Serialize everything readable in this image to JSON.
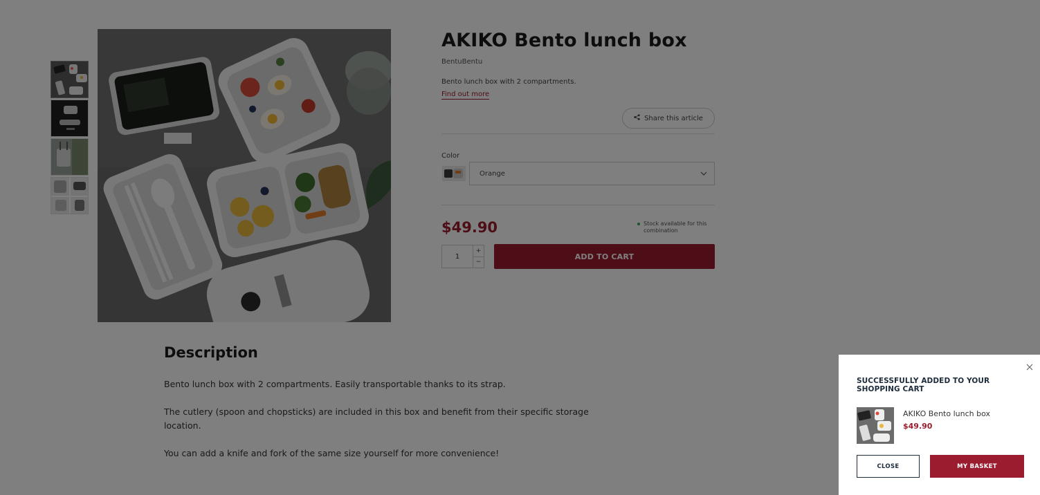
{
  "product": {
    "title": "AKIKO Bento lunch box",
    "brand": "BentuBentu",
    "short_description": "Bento lunch box with 2 compartments.",
    "find_more": "Find out more",
    "share_label": "Share this article",
    "color_label": "Color",
    "color_selected": "Orange",
    "price": "$49.90",
    "stock_text": "Stock available for this combination",
    "quantity": "1",
    "qty_plus": "+",
    "qty_minus": "−",
    "add_to_cart": "ADD TO CART"
  },
  "description": {
    "title": "Description",
    "paragraphs": [
      "Bento lunch box with 2 compartments. Easily transportable thanks to its strap.",
      "The cutlery (spoon and chopsticks) are included in this box and benefit from their specific storage location.",
      "You can add a knife and fork of the same size yourself for more convenience!"
    ]
  },
  "toast": {
    "title": "SUCCESSFULLY ADDED TO YOUR SHOPPING CART",
    "item_name": "AKIKO Bento lunch box",
    "item_price": "$49.90",
    "close_label": "CLOSE",
    "basket_label": "MY BASKET"
  },
  "colors": {
    "accent": "#9b1c2e",
    "navy": "#1c2b3a",
    "stock_dot": "#3aa35a",
    "overlay": "rgba(0,0,0,0.5)"
  }
}
